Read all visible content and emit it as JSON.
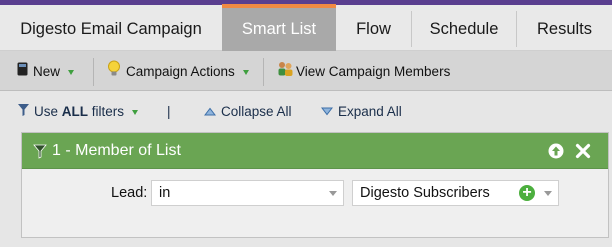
{
  "tabs": [
    {
      "label": "Digesto Email Campaign",
      "active": false
    },
    {
      "label": "Smart List",
      "active": true
    },
    {
      "label": "Flow",
      "active": false
    },
    {
      "label": "Schedule",
      "active": false
    },
    {
      "label": "Results",
      "active": false
    }
  ],
  "toolbar": {
    "new_label": "New",
    "new_icon": "new-document-icon",
    "campaign_actions_label": "Campaign Actions",
    "campaign_actions_icon": "lightbulb-icon",
    "view_members_label": "View Campaign Members",
    "view_members_icon": "people-icon"
  },
  "filter_options": {
    "use_label_prefix": "Use",
    "use_label_strong": "ALL",
    "use_label_suffix": "filters",
    "separator": "|",
    "collapse_label": "Collapse All",
    "expand_label": "Expand All"
  },
  "filter": {
    "title": "1 - Member of List",
    "field_label": "Lead:",
    "operator": "in",
    "value": "Digesto Subscribers"
  },
  "colors": {
    "tab_accent": "#f08a43",
    "brand_strip": "#5a3f8f",
    "filter_header": "#6aa553",
    "add_button": "#4caf3e"
  }
}
